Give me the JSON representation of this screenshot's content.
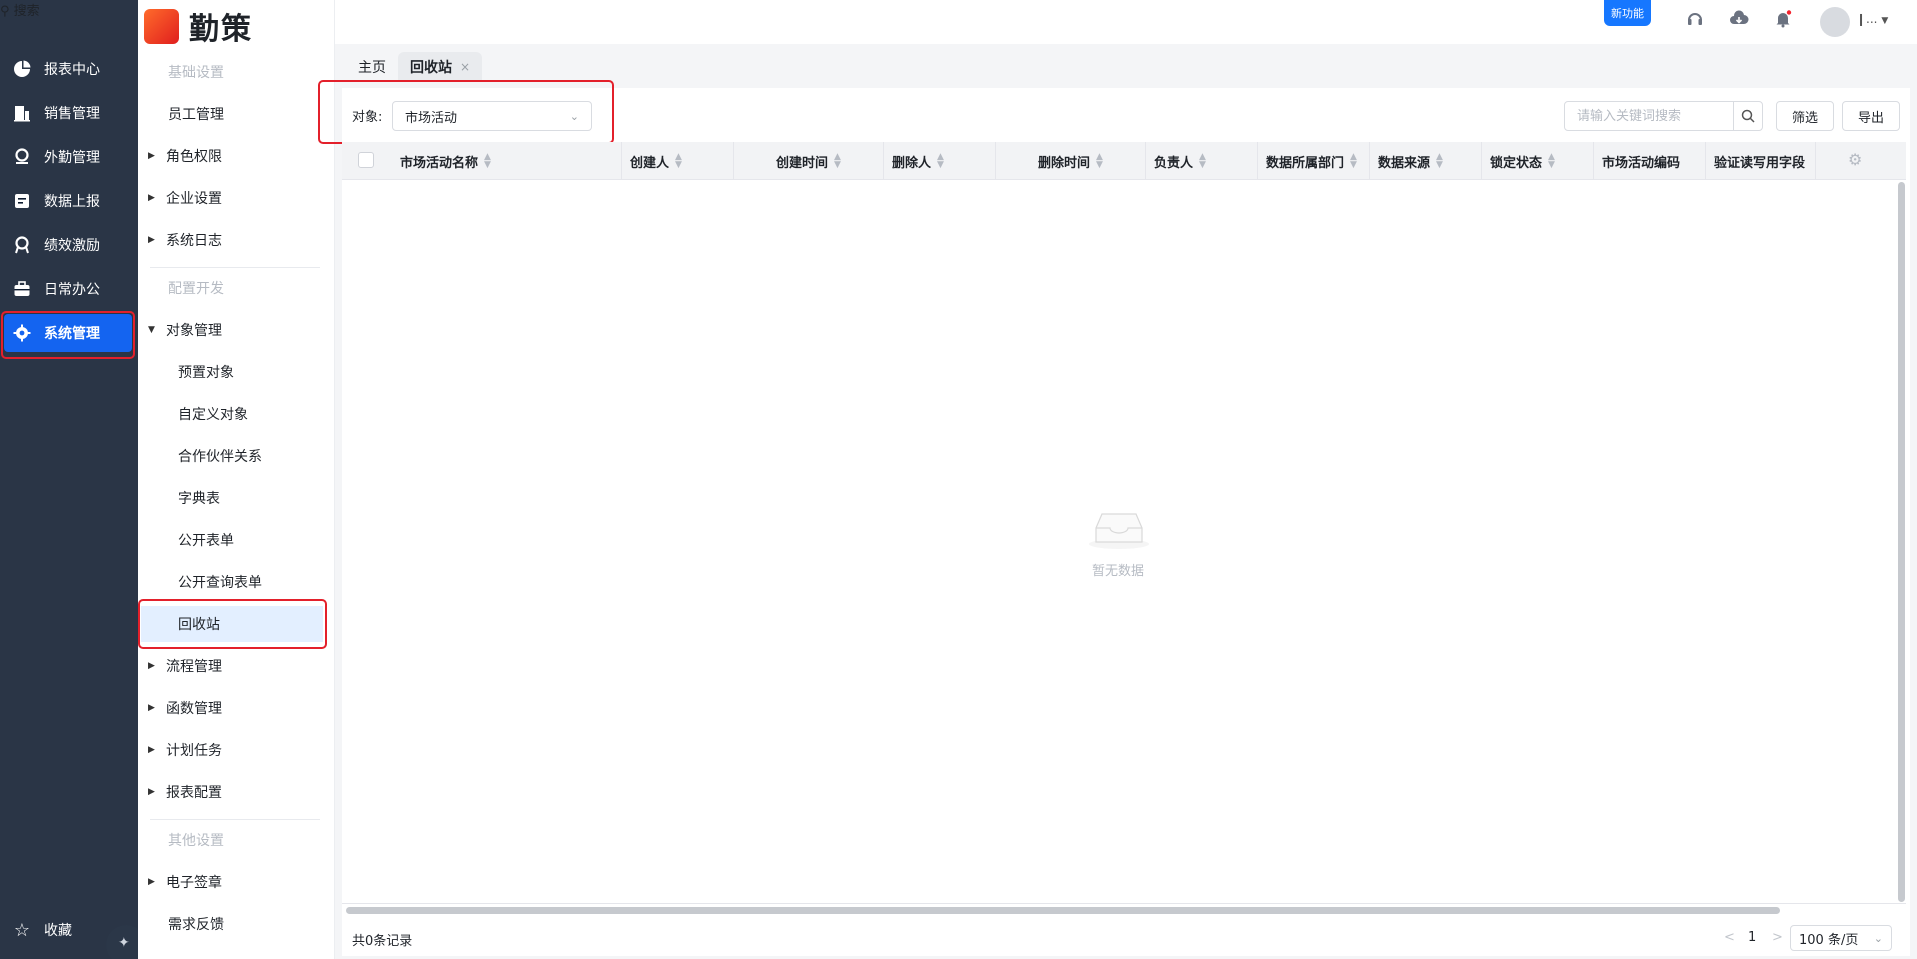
{
  "app": {
    "name": "勤策",
    "search_placeholder": "搜索"
  },
  "leftnav": {
    "items": [
      {
        "label": "报表中心",
        "icon": "pie-chart-icon"
      },
      {
        "label": "销售管理",
        "icon": "building-icon"
      },
      {
        "label": "外勤管理",
        "icon": "location-icon"
      },
      {
        "label": "数据上报",
        "icon": "form-icon"
      },
      {
        "label": "绩效激励",
        "icon": "medal-icon"
      },
      {
        "label": "日常办公",
        "icon": "briefcase-icon"
      },
      {
        "label": "系统管理",
        "icon": "gear-icon",
        "active": true
      }
    ],
    "favorites": "收藏"
  },
  "subnav": {
    "group_basic": "基础设置",
    "employee": "员工管理",
    "roles": "角色权限",
    "company": "企业设置",
    "logs": "系统日志",
    "group_dev": "配置开发",
    "object_mgmt": "对象管理",
    "preset": "预置对象",
    "custom": "自定义对象",
    "partner": "合作伙伴关系",
    "dict": "字典表",
    "public_form": "公开表单",
    "public_query": "公开查询表单",
    "recycle": "回收站",
    "process": "流程管理",
    "function": "函数管理",
    "plan": "计划任务",
    "report_config": "报表配置",
    "group_other": "其他设置",
    "esign": "电子签章",
    "feedback": "需求反馈"
  },
  "header": {
    "new_feature": "新功能",
    "username": "❙..."
  },
  "tabs": {
    "home": "主页",
    "recycle": "回收站",
    "close": "×"
  },
  "filter": {
    "object_label": "对象:",
    "object_value": "市场活动",
    "search_placeholder": "请输入关键词搜索",
    "filter_btn": "筛选",
    "export_btn": "导出"
  },
  "table": {
    "columns": [
      "市场活动名称",
      "创建人",
      "创建时间",
      "删除人",
      "删除时间",
      "负责人",
      "数据所属部门",
      "数据来源",
      "锁定状态",
      "市场活动编码",
      "验证读写用字段"
    ],
    "rows": [],
    "empty_text": "暂无数据"
  },
  "footer": {
    "total": "共0条记录",
    "page": "1",
    "prev": "<",
    "next": ">",
    "page_size": "100 条/页"
  }
}
